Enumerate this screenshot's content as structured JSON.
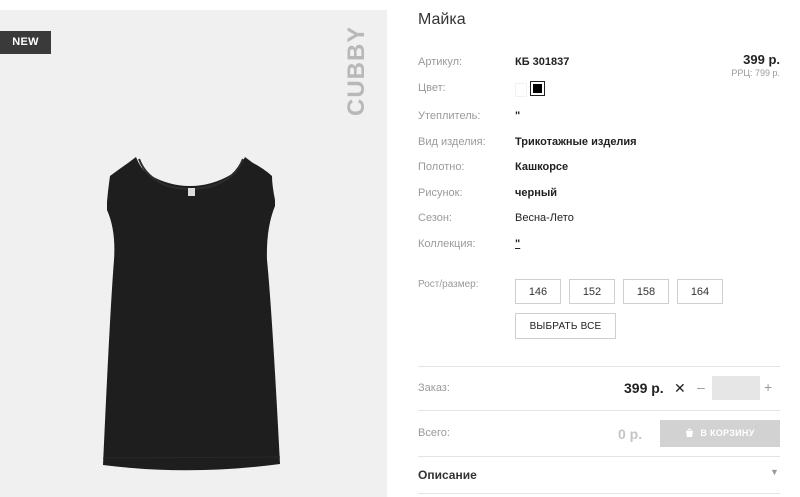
{
  "product": {
    "title": "Майка",
    "badge": "NEW",
    "brand_logo": "CUBBY",
    "price": "399 р.",
    "rrp": "РРЦ: 799 р."
  },
  "attributes": [
    {
      "label": "Артикул:",
      "value": "КБ 301837"
    },
    {
      "label": "Цвет:",
      "value": ""
    },
    {
      "label": "Утеплитель:",
      "value": "\""
    },
    {
      "label": "Вид изделия:",
      "value": "Трикотажные изделия"
    },
    {
      "label": "Полотно:",
      "value": "Кашкорсе"
    },
    {
      "label": "Рисунок:",
      "value": "черный"
    },
    {
      "label": "Сезон:",
      "value": "Весна-Лето"
    },
    {
      "label": "Коллекция:",
      "value": "\""
    }
  ],
  "colors": [
    {
      "name": "white",
      "hex": "#ffffff",
      "selected": false
    },
    {
      "name": "black",
      "hex": "#000000",
      "selected": true
    }
  ],
  "sizes": {
    "label": "Рост/размер:",
    "options": [
      "146",
      "152",
      "158",
      "164"
    ],
    "select_all": "ВЫБРАТЬ ВСЕ"
  },
  "order": {
    "label": "Заказ:",
    "price": "399 р.",
    "times": "✕",
    "minus": "–",
    "plus": "+",
    "quantity": ""
  },
  "total": {
    "label": "Всего:",
    "value": "0 р.",
    "cart_button": "В КОРЗИНУ"
  },
  "description": {
    "label": "Описание",
    "caret": "▼"
  },
  "icons": {
    "cart": "cart-icon",
    "caret": "chevron-down-icon"
  }
}
